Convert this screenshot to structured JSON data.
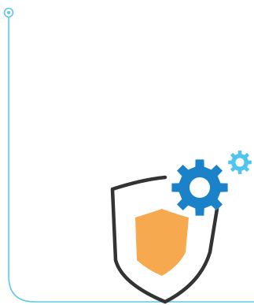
{
  "colors": {
    "timeline_line": "#5bc9e8",
    "timeline_dot": "#5bc9e8",
    "shield_outline": "#333333",
    "shield_fill": "#f6a94f",
    "gear_large": "#1b82c9",
    "gear_small": "#4ec4ee"
  },
  "icons": {
    "timeline": "timeline-connector",
    "security": "shield-icon",
    "settings_large": "gear-icon",
    "settings_small": "gear-icon"
  }
}
